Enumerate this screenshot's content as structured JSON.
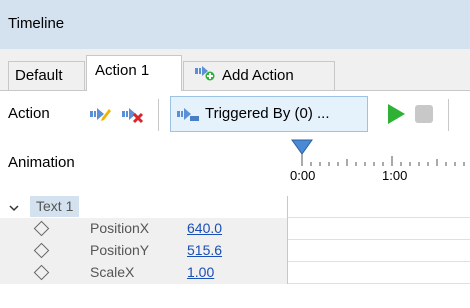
{
  "panel": {
    "title": "Timeline"
  },
  "tabs": [
    {
      "label": "Default"
    },
    {
      "label": "Action 1"
    },
    {
      "label": "Add Action"
    }
  ],
  "toolbar": {
    "action_label": "Action",
    "triggered_by_label": "Triggered By (0) ..."
  },
  "animation": {
    "label": "Animation",
    "ruler_labels": [
      "0:00",
      "1:00"
    ]
  },
  "tree": {
    "group_label": "Text 1",
    "properties": [
      {
        "name": "PositionX",
        "value": "640.0"
      },
      {
        "name": "PositionY",
        "value": "515.6"
      },
      {
        "name": "ScaleX",
        "value": "1.00"
      }
    ]
  },
  "colors": {
    "header_bg": "#d4e1ef",
    "link_blue": "#1a4fb6",
    "play_green": "#2eb135",
    "delete_red": "#d9262d"
  }
}
